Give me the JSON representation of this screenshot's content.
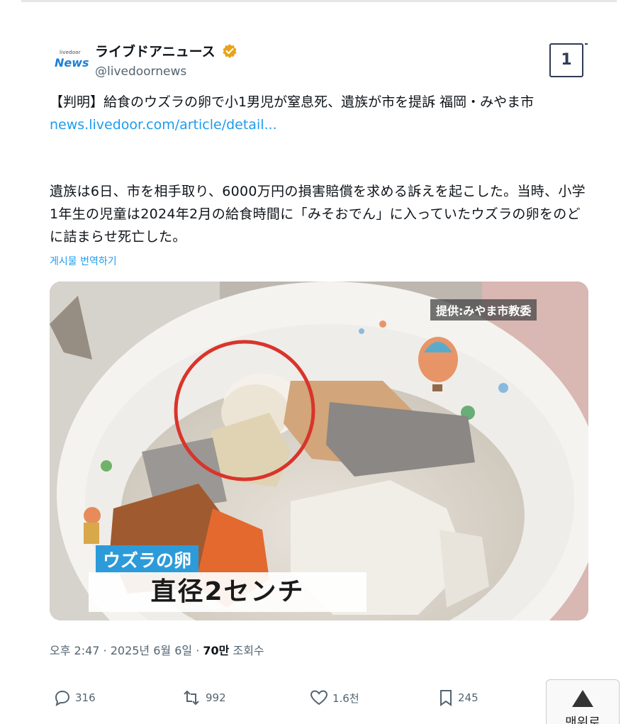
{
  "account": {
    "logo_small": "livedoor",
    "logo_big": "News",
    "name": "ライブドアニュース",
    "handle": "@livedoornews",
    "grok_label": "1"
  },
  "tweet": {
    "headline": "【判明】給食のウズラの卵で小1男児が窒息死、遺族が市を提訴 福岡・みやま市",
    "link": "news.livedoor.com/article/detail...",
    "body": "遺族は6日、市を相手取り、6000万円の損害賠償を求める訴えを起こした。当時、小学1年生の児童は2024年2月の給食時間に「みそおでん」に入っていたウズラの卵をのどに詰まらせ死亡した。",
    "translate_label": "게시물 번역하기"
  },
  "photo": {
    "credit": "提供:みやま市教委",
    "caption_label": "ウズラの卵",
    "caption_main": "直径2センチ"
  },
  "meta": {
    "time": "오후 2:47 · 2025년 6월 6일 · ",
    "views": "70만",
    "views_suffix": " 조회수"
  },
  "actions": {
    "replies": "316",
    "reposts": "992",
    "likes": "1.6천",
    "bookmarks": "245"
  },
  "scroll_top": {
    "label": "맨위로"
  },
  "colors": {
    "link": "#1d9bf0",
    "verified": "#e8a317",
    "caption_label_bg": "#2d9bd9",
    "circle": "#d9342b"
  }
}
